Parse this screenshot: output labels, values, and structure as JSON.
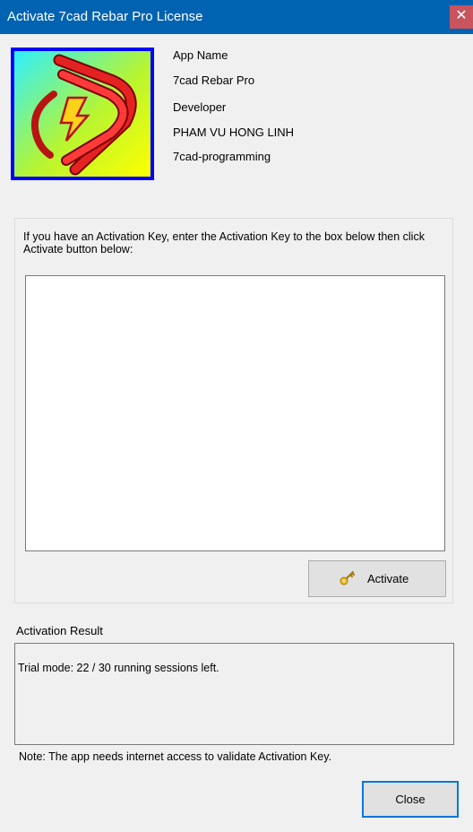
{
  "window": {
    "title": "Activate 7cad Rebar Pro License",
    "close_glyph": "✕"
  },
  "app_info": {
    "app_name_label": "App Name",
    "app_name": "7cad Rebar Pro",
    "developer_label": "Developer",
    "developer": "PHAM VU HONG LINH",
    "organization": "7cad-programming"
  },
  "activation": {
    "instructions": "If you have an Activation Key, enter the Activation Key to the box below then click Activate button below:",
    "key_value": "",
    "activate_label": "Activate",
    "activate_icon": "key-icon"
  },
  "result": {
    "label": "Activation Result",
    "text": "Trial mode: 22 / 30 running sessions left."
  },
  "note": "Note: The app needs internet access to validate Activation Key.",
  "footer": {
    "close_label": "Close"
  },
  "colors": {
    "titlebar": "#0063b1",
    "close_button": "#c9545d",
    "logo_border": "#0000ff",
    "accent": "#0078d7"
  }
}
